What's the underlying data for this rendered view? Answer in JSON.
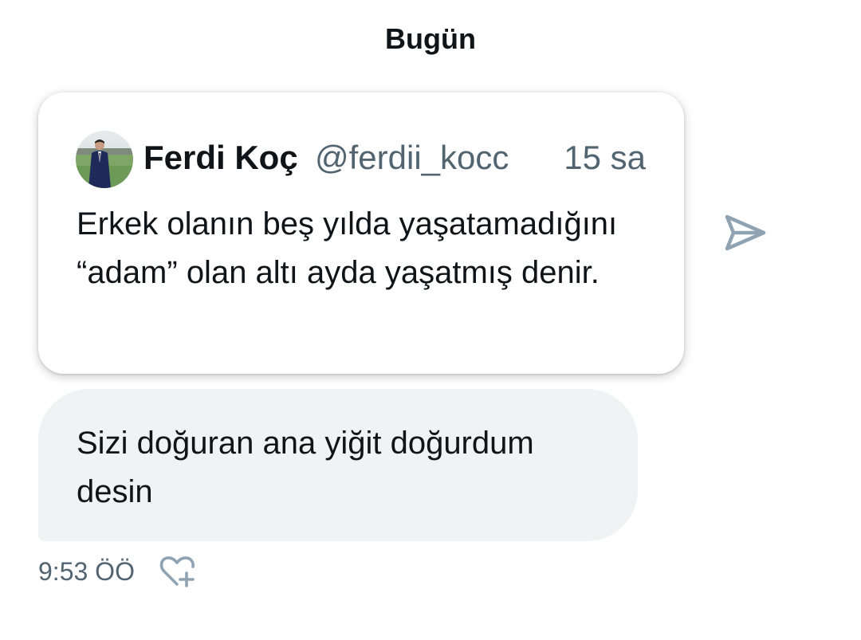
{
  "conversation": {
    "day_label": "Bugün"
  },
  "shared_tweet": {
    "author_name": "Ferdi Koç",
    "author_handle": "@ferdii_kocc",
    "time": "15 sa",
    "text": "Erkek olanın beş yılda yaşatamadığını “adam” olan altı ayda yaşatmış denir.",
    "avatar_icon": "person-in-suit-avatar"
  },
  "actions": {
    "share_icon": "send-arrow-icon",
    "react_icon": "heart-plus-icon"
  },
  "message": {
    "text": "Sizi doğuran ana yiğit doğurdum desin",
    "time": "9:53 ÖÖ"
  },
  "colors": {
    "text_primary": "#0f1419",
    "text_secondary": "#536471",
    "bubble_background": "#eff3f4",
    "icon_gray": "#8fa3b3"
  }
}
